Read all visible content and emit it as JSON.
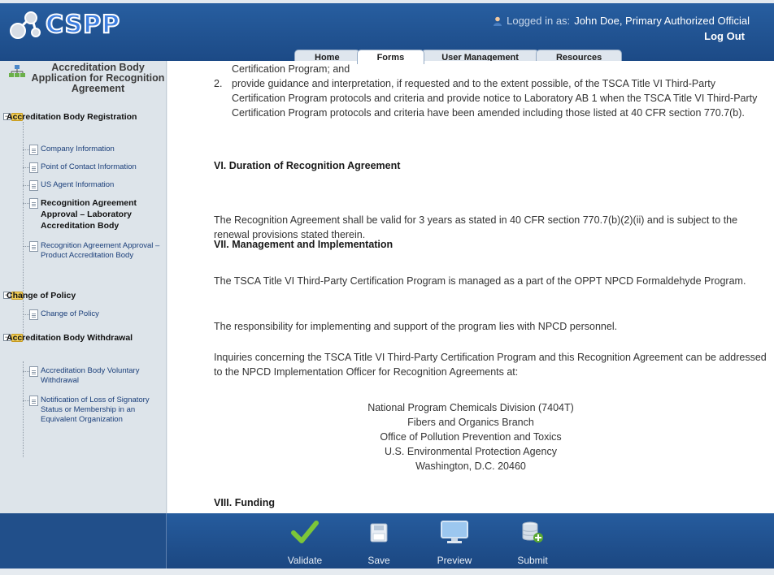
{
  "header": {
    "logo_text": "CSPP",
    "login_prefix": "Logged in as:",
    "user": "John Doe, Primary Authorized Official",
    "logout_label": "Log Out",
    "tabs": [
      {
        "label": "Home"
      },
      {
        "label": "Forms"
      },
      {
        "label": "User Management"
      },
      {
        "label": "Resources"
      }
    ],
    "active_tab": "Forms"
  },
  "sidebar": {
    "title": "Accreditation Body Application for Recognition Agreement",
    "groups": [
      {
        "label": "Accreditation Body Registration",
        "items": [
          {
            "label": "Company Information"
          },
          {
            "label": "Point of Contact Information"
          },
          {
            "label": "US Agent Information"
          },
          {
            "label": "Recognition Agreement Approval – Laboratory Accreditation Body"
          },
          {
            "label": "Recognition Agreement Approval – Product Accreditation Body"
          }
        ]
      },
      {
        "label": "Change of Policy",
        "items": [
          {
            "label": "Change of Policy"
          }
        ]
      },
      {
        "label": "Accreditation Body Withdrawal",
        "items": [
          {
            "label": "Accreditation Body Voluntary Withdrawal"
          },
          {
            "label": "Notification of Loss of Signatory Status or Membership in an Equivalent Organization"
          }
        ]
      }
    ]
  },
  "content": {
    "line_top": "Certification Program; and",
    "item2_num": "2.",
    "item2": "provide guidance and interpretation, if requested and to the extent possible, of the TSCA Title VI Third-Party Certification Program protocols and criteria and provide notice to Laboratory AB 1 when the TSCA Title VI Third-Party Certification Program protocols and criteria have been amended including those listed at 40 CFR section 770.7(b).",
    "h6": "VI. Duration of Recognition Agreement",
    "p6": "The Recognition Agreement shall be valid for 3 years as stated in 40 CFR section 770.7(b)(2)(ii) and is subject to the renewal provisions stated therein.",
    "h7": "VII. Management and Implementation",
    "p7a": "The TSCA Title VI Third-Party Certification Program is managed as a part of the OPPT NPCD Formaldehyde Program.",
    "p7b": "The responsibility for implementing and support of the program lies with NPCD personnel.",
    "p7c": "Inquiries concerning the TSCA Title VI Third-Party Certification Program and this Recognition Agreement can be addressed to the NPCD Implementation Officer for Recognition Agreements at:",
    "address": [
      "National Program Chemicals Division (7404T)",
      "Fibers and Organics Branch",
      "Office of Pollution Prevention and Toxics",
      "U.S. Environmental Protection Agency",
      "Washington, D.C. 20460"
    ],
    "h8": "VIII. Funding"
  },
  "footer": {
    "validate_label": "Validate",
    "save_label": "Save",
    "preview_label": "Preview",
    "submit_label": "Submit"
  },
  "colors": {
    "header_bg": "#1f4e8c",
    "validate_check": "#7cc639"
  }
}
